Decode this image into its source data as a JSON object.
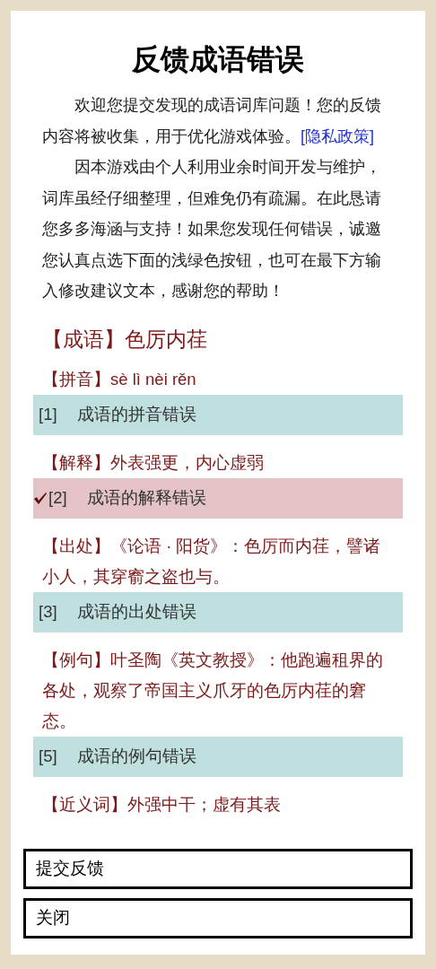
{
  "title": "反馈成语错误",
  "intro": [
    {
      "text": "欢迎您提交发现的成语词库问题！您的反馈内容将被收集，用于优化游戏体验。",
      "link": "[隐私政策]"
    },
    {
      "text": "因本游戏由个人利用业余时间开发与维护，词库虽经仔细整理，但难免仍有疏漏。在此恳请您多多海涵与支持！如果您发现任何错误，诚邀您认真点选下面的浅绿色按钮，也可在最下方输入修改建议文本，感谢您的帮助！"
    }
  ],
  "idiom": {
    "label": "【成语】",
    "value": "色厉内荏"
  },
  "sections": [
    {
      "label": "【拼音】",
      "text": "sè lì nèi rěn",
      "option": {
        "number": "[1]",
        "label": "成语的拼音错误",
        "selected": false
      }
    },
    {
      "label": "【解释】",
      "text": "外表强更，内心虚弱",
      "option": {
        "number": "[2]",
        "label": "成语的解释错误",
        "selected": true
      }
    },
    {
      "label": "【出处】",
      "text": "《论语 · 阳货》：色厉而内荏，譬诸小人，其穿窬之盗也与。",
      "option": {
        "number": "[3]",
        "label": "成语的出处错误",
        "selected": false
      }
    },
    {
      "label": "【例句】",
      "text": "叶圣陶《英文教授》：他跑遍租界的各处，观察了帝国主义爪牙的色厉内荏的窘态。",
      "option": {
        "number": "[5]",
        "label": "成语的例句错误",
        "selected": false
      }
    },
    {
      "label": "【近义词】",
      "text": "外强中干；虚有其表"
    }
  ],
  "buttons": [
    "提交反馈",
    "关闭"
  ]
}
